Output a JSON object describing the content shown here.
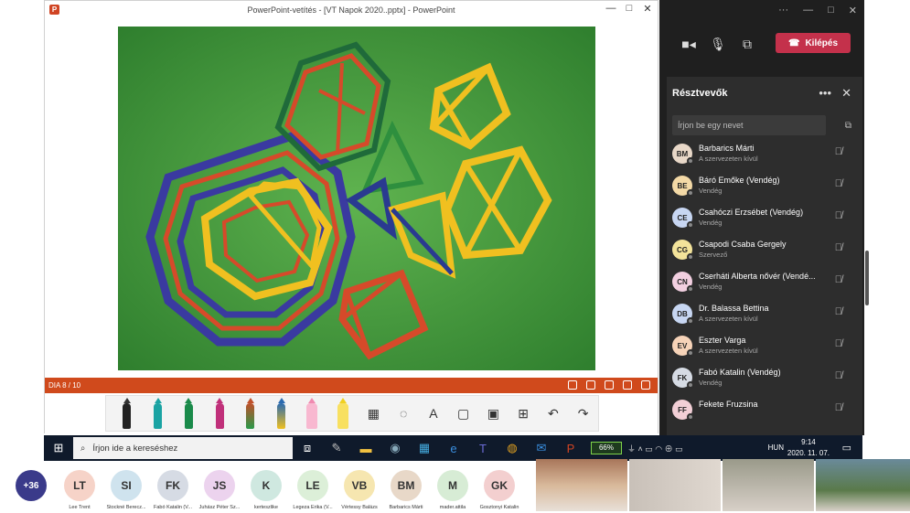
{
  "ppt": {
    "title": "PowerPoint-vetítés - [VT Napok 2020..pptx] - PowerPoint",
    "slide_counter": "DIA 8 / 10",
    "window_controls": [
      "—",
      "□",
      "✕"
    ]
  },
  "teams": {
    "leave_label": "Kilépés",
    "panel_title": "Résztvevők",
    "search_placeholder": "Írjon be egy nevet",
    "participants": [
      {
        "initials": "BM",
        "name": "Barbarics Márti",
        "sub": "A szervezeten kívül",
        "color": "#e8d8c8"
      },
      {
        "initials": "BE",
        "name": "Báró Emőke (Vendég)",
        "sub": "Vendég",
        "color": "#f3d9a6"
      },
      {
        "initials": "CE",
        "name": "Csahóczi Erzsébet (Vendég)",
        "sub": "Vendég",
        "color": "#c7d6f2"
      },
      {
        "initials": "CG",
        "name": "Csapodi Csaba Gergely",
        "sub": "Szervező",
        "color": "#f3e39a"
      },
      {
        "initials": "CN",
        "name": "Cserháti Alberta nővér (Vendé...",
        "sub": "Vendég",
        "color": "#f2cfe0"
      },
      {
        "initials": "DB",
        "name": "Dr. Balassa Bettina",
        "sub": "A szervezeten kívül",
        "color": "#c7d6f2"
      },
      {
        "initials": "EV",
        "name": "Eszter Varga",
        "sub": "A szervezeten kívül",
        "color": "#f6d3b8"
      },
      {
        "initials": "FK",
        "name": "Fabó Katalin (Vendég)",
        "sub": "Vendég",
        "color": "#d6dbe4"
      },
      {
        "initials": "FF",
        "name": "Fekete Fruzsina",
        "sub": "",
        "color": "#f2cfd6"
      }
    ]
  },
  "taskbar": {
    "search_placeholder": "Írjon ide a kereséshez",
    "battery": "66%",
    "lang": "HUN",
    "time": "9:14",
    "date": "2020. 11. 07."
  },
  "strip": {
    "more_count": "+36",
    "attendees": [
      {
        "initials": "LT",
        "name": "Lee Trent",
        "color": "#f6d3c8"
      },
      {
        "initials": "SI",
        "name": "Stockné Berecz...",
        "color": "#cfe3ee"
      },
      {
        "initials": "FK",
        "name": "Fabó Katalin (V...",
        "color": "#d6dbe4"
      },
      {
        "initials": "JS",
        "name": "Juhász Péter Sz...",
        "color": "#ecd3ee"
      },
      {
        "initials": "K",
        "name": "kerteszlike",
        "color": "#cfe8e0"
      },
      {
        "initials": "LE",
        "name": "Legeza Erika (V...",
        "color": "#dcefd8"
      },
      {
        "initials": "VB",
        "name": "Vértessy Balázs",
        "color": "#f6e6b0"
      },
      {
        "initials": "BM",
        "name": "Barbarics Márti",
        "color": "#e8d8c8"
      },
      {
        "initials": "M",
        "name": "mader.attila",
        "color": "#d7ecd5"
      },
      {
        "initials": "GK",
        "name": "Gosztonyi Katalin",
        "color": "#f3cfcf"
      }
    ]
  }
}
